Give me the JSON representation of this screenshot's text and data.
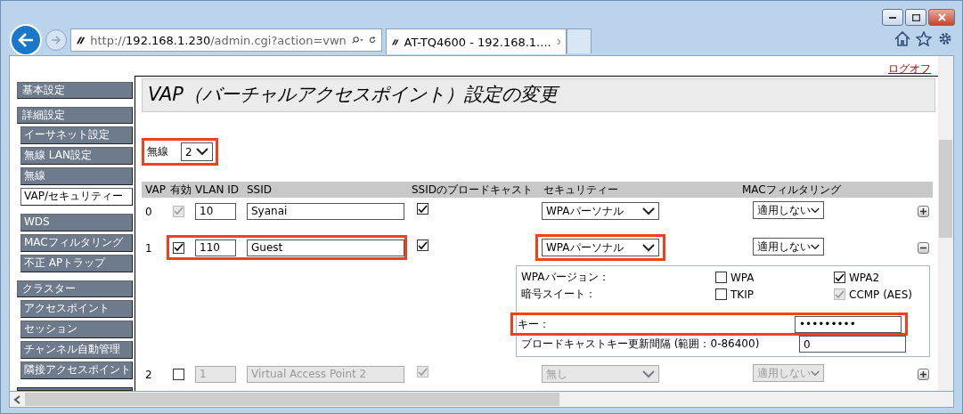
{
  "browser": {
    "address_scheme": "http://",
    "address_host": "192.168.1.230",
    "address_path": "/admin.cgi?action=vwn",
    "tab_title": "AT-TQ4600 - 192.168.1...."
  },
  "logout": "ログオフ",
  "sidebar": [
    {
      "label": "基本設定"
    },
    {
      "label": "詳細設定",
      "items": [
        {
          "label": "イーサネット設定",
          "selected": false
        },
        {
          "label": "無線 LAN設定",
          "selected": false
        },
        {
          "label": "無線",
          "selected": false
        },
        {
          "label": "VAP/セキュリティー",
          "selected": true
        }
      ]
    },
    {
      "items": [
        {
          "label": "WDS",
          "selected": false
        },
        {
          "label": "MACフィルタリング",
          "selected": false
        },
        {
          "label": "不正 APトラップ",
          "selected": false
        }
      ]
    },
    {
      "label": "クラスター",
      "items": [
        {
          "label": "アクセスポイント",
          "selected": false
        },
        {
          "label": "セッション",
          "selected": false
        },
        {
          "label": "チャンネル自動管理",
          "selected": false
        },
        {
          "label": "隣接アクセスポイント",
          "selected": false
        }
      ]
    }
  ],
  "page_title": "VAP（バーチャルアクセスポイント）設定の変更",
  "radio": {
    "label": "無線",
    "value": "2",
    "highlighted": true
  },
  "columns": [
    "VAP",
    "有効",
    "VLAN ID",
    "SSID",
    "SSIDのブロードキャスト",
    "セキュリティー",
    "MACフィルタリング"
  ],
  "rows": [
    {
      "vap": "0",
      "enabled": true,
      "enabled_disabled": true,
      "vlan_id": "10",
      "ssid": "Syanai",
      "broadcast": true,
      "security": "WPAパーソナル",
      "mac_filter": "適用しない",
      "disabled": false,
      "expanded": false,
      "highlighted": false
    },
    {
      "vap": "1",
      "enabled": true,
      "enabled_disabled": false,
      "vlan_id": "110",
      "ssid": "Guest",
      "broadcast": true,
      "security": "WPAパーソナル",
      "mac_filter": "適用しない",
      "disabled": false,
      "expanded": true,
      "highlighted": true
    },
    {
      "vap": "2",
      "enabled": false,
      "enabled_disabled": false,
      "vlan_id": "1",
      "ssid": "Virtual Access Point 2",
      "broadcast": true,
      "security": "無し",
      "mac_filter": "適用しない",
      "disabled": true,
      "expanded": false,
      "highlighted": false
    }
  ],
  "detail": {
    "wpa_version_label": "WPAバージョン：",
    "wpa_versions": [
      {
        "label": "WPA",
        "checked": false,
        "disabled": false
      },
      {
        "label": "WPA2",
        "checked": true,
        "disabled": false
      }
    ],
    "cipher_label": "暗号スイート：",
    "ciphers": [
      {
        "label": "TKIP",
        "checked": false,
        "disabled": false
      },
      {
        "label": "CCMP (AES)",
        "checked": true,
        "disabled": true
      }
    ],
    "key_label": "キー：",
    "key_value": "•••••••••",
    "key_highlighted": true,
    "interval_label": "ブロードキャストキー更新間隔 (範囲：0-86400)",
    "interval_value": "0"
  }
}
